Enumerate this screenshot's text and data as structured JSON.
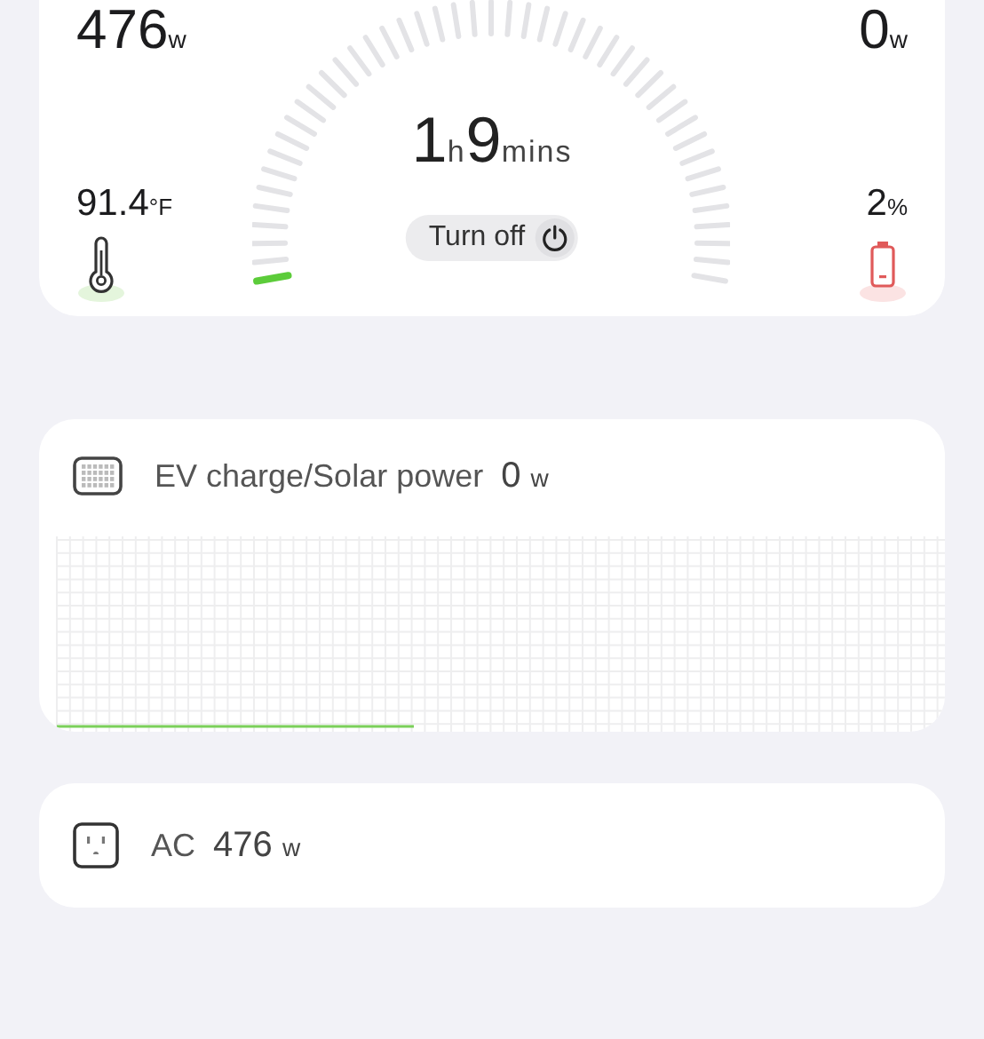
{
  "stats": {
    "output": {
      "value": "476",
      "unit": "w"
    },
    "input": {
      "value": "0",
      "unit": "w"
    },
    "temperature": {
      "value": "91.4",
      "unit": "°F"
    },
    "battery": {
      "value": "2",
      "unit": "%"
    }
  },
  "gauge": {
    "hours": "1",
    "hours_unit": "h",
    "minutes": "9",
    "minutes_unit": "mins"
  },
  "turn_off": {
    "label": "Turn off"
  },
  "panels": [
    {
      "kind": "solar",
      "title": "EV charge/Solar power",
      "value": "0",
      "unit": "w"
    },
    {
      "kind": "ac",
      "title": "AC",
      "value": "476",
      "unit": "w"
    }
  ]
}
